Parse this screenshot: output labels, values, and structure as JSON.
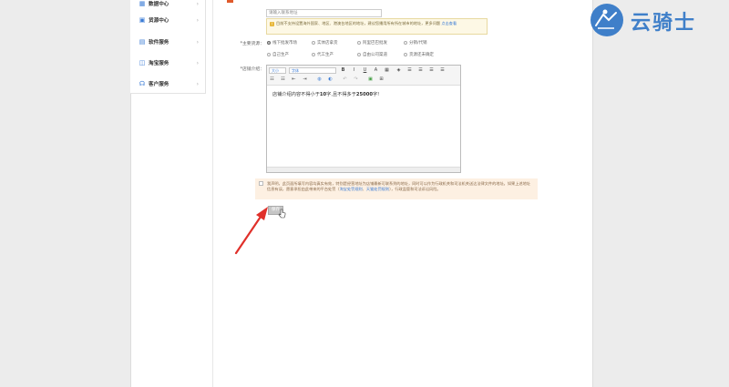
{
  "sidebar": {
    "items": [
      {
        "label": "数据中心",
        "icon": "chart-icon"
      },
      {
        "label": "货源中心",
        "icon": "box-icon"
      },
      {
        "label": "软件服务",
        "icon": "grid-icon"
      },
      {
        "label": "淘宝服务",
        "icon": "taobao-icon"
      },
      {
        "label": "客户服务",
        "icon": "support-icon"
      }
    ]
  },
  "address": {
    "placeholder": "请输入联系地址"
  },
  "notice": {
    "text": "目前不支持设置海外国家、地区、港澳台地区的地址，建议您播用所有所在城市的地址，更多问题",
    "link": "点击查看"
  },
  "main_source": {
    "label": "*主要货源：",
    "options": [
      {
        "label": "线下批发市场",
        "selected": true
      },
      {
        "label": "实体店拿货",
        "selected": false
      },
      {
        "label": "阿里巴巴批发",
        "selected": false
      },
      {
        "label": "分销/代销",
        "selected": false
      },
      {
        "label": "自己生产",
        "selected": false
      },
      {
        "label": "代工生产",
        "selected": false
      },
      {
        "label": "自由公司渠道",
        "selected": false
      },
      {
        "label": "货源还未确定",
        "selected": false
      }
    ]
  },
  "shop_intro": {
    "label": "*店铺介绍：",
    "toolbar": {
      "size_select": "大小",
      "font_select": "字体"
    },
    "content_prefix": "店铺介绍内容不得小于",
    "min_value": "10",
    "content_middle": "字,且不得多于",
    "max_value": "25000",
    "content_suffix": "字!"
  },
  "disclaimer": {
    "text_1": "我声明，此页面所填写内容均真实有效，特别是经营地址为店铺最新可联系到的地址，同时可以作为行政机关和司法机关送达法律文件的地址。如果上述地址信息有误，愿意承担由此带来的平台处罚（",
    "link_1": "淘宝处罚规则",
    "text_2": "、",
    "link_2": "天猫处罚规则",
    "text_3": "），行政监管和司法诉讼风险。"
  },
  "submit": {
    "label": "保存"
  },
  "watermark": {
    "brand": "云骑士"
  },
  "colors": {
    "accent": "#3a7bd5",
    "annotation_arrow": "#e0302a",
    "brand": "#3f7fc9"
  }
}
